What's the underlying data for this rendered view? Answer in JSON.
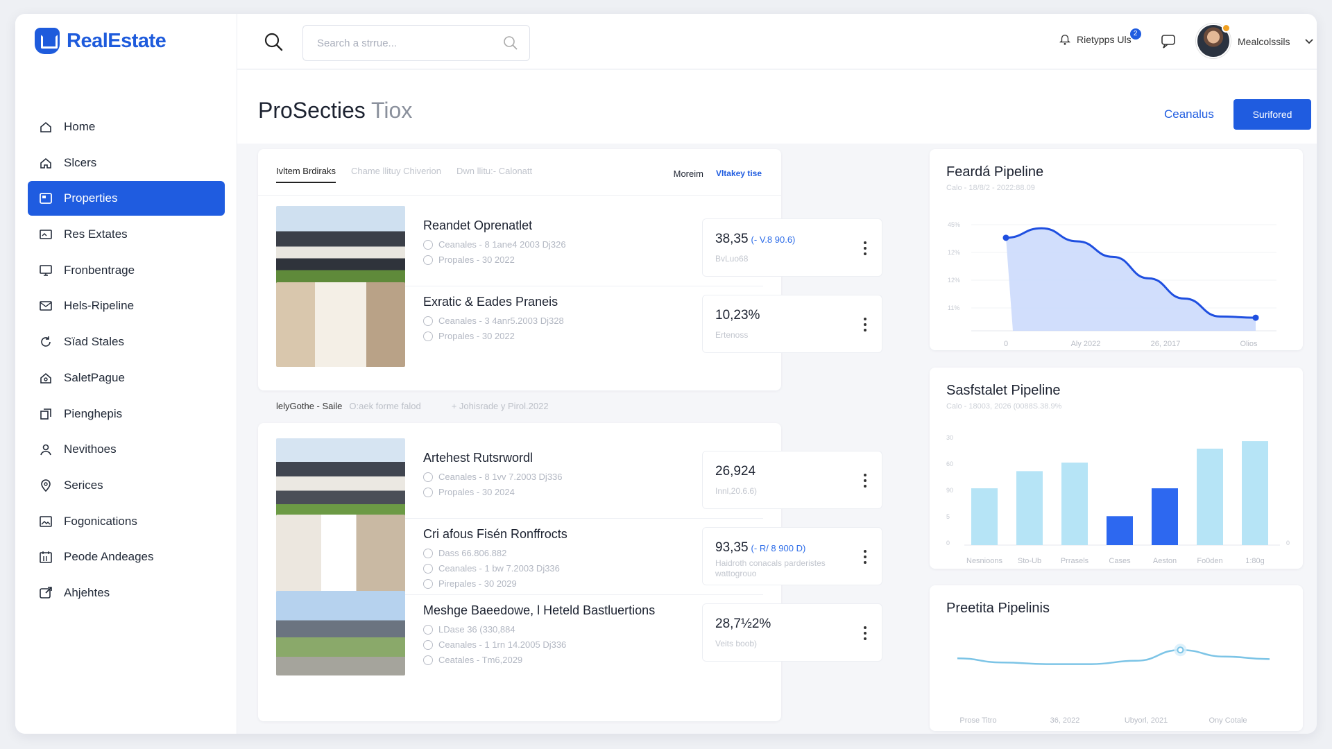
{
  "app": {
    "brand": "RealEstate",
    "brand_color": "#1e5bdc",
    "accent": "#1f5ce0"
  },
  "sidebar": {
    "items": [
      {
        "label": "Home",
        "icon": "home-icon"
      },
      {
        "label": "Slcers",
        "icon": "home-outline-icon"
      },
      {
        "label": "Properties",
        "icon": "properties-icon",
        "active": true
      },
      {
        "label": "Res Extates",
        "icon": "image-icon"
      },
      {
        "label": "Fronbentrage",
        "icon": "monitor-icon"
      },
      {
        "label": "Hels-Ripeline",
        "icon": "mail-chart-icon"
      },
      {
        "label": "Sïad Stales",
        "icon": "refresh-icon"
      },
      {
        "label": "SaletPague",
        "icon": "house-gear-icon"
      },
      {
        "label": "Pienghepis",
        "icon": "copy-icon"
      },
      {
        "label": "Nevithoes",
        "icon": "user-icon"
      },
      {
        "label": "Serices",
        "icon": "location-pin-icon"
      },
      {
        "label": "Fogonications",
        "icon": "photo-icon"
      },
      {
        "label": "Peode Andeages",
        "icon": "calendar-icon"
      },
      {
        "label": "Ahjehtes",
        "icon": "export-icon"
      }
    ]
  },
  "topbar": {
    "search_placeholder": "Search a strrue...",
    "notifications_label": "Rietypps Uls",
    "notifications_count": "2",
    "username": "Mealcolssils"
  },
  "header": {
    "title": "ProSecties",
    "title_suffix": "Tiox",
    "link_button": "Ceanalus",
    "primary_button": "Surifored"
  },
  "listing_top": {
    "tabs": [
      "Ivltem Brdiraks",
      "Chame llituy Chiverion",
      "Dwn llitu:- Calonatt"
    ],
    "right_tabs": [
      "Moreim",
      "Vltakey tise"
    ],
    "rows": [
      {
        "title": "Reandet Oprenatlet",
        "meta": [
          "Ceanales - 8 1ane4 2003 Dj326",
          "Propales - 30 2022"
        ],
        "price": "38,35",
        "change": "(- V.8 90.6)",
        "sub": "BvLuo68"
      },
      {
        "title": "Exratic & Eades Praneis",
        "meta": [
          "Ceanales - 3 4anr5.2003 Dj328",
          "Propales - 30 2022"
        ],
        "price": "10,23%",
        "change": "",
        "sub": "Ertenoss"
      }
    ]
  },
  "section": {
    "label": "lelyGothe - Saile",
    "middle": "O:aek forme falod",
    "right": "+ Johisrade y Pirol.2022"
  },
  "listing_bottom": {
    "rows": [
      {
        "title": "Artehest Rutsrwordl",
        "meta": [
          "Ceanales - 8 1vv 7.2003 Dj336",
          "Propales - 30 2024"
        ],
        "price": "26,924",
        "change": "",
        "sub": "Innl,20.6.6)"
      },
      {
        "title": "Cri afous Fisén Ronffrocts",
        "meta": [
          "Dass 66.806.882",
          "Ceanales - 1 bw 7.2003 Dj336",
          "Pirepales - 30 2029"
        ],
        "price": "93,35",
        "change": "(- R/ 8 900 D)",
        "sub": "Haidroth conacals parderistes wattogrouo"
      },
      {
        "title": "Meshge Baeedowe, l Heteld Bastluertions",
        "meta": [
          "LDase 36 (330,884",
          "Ceanales - 1 1rn 14.2005 Dj336",
          "Ceatales - Tm6,2029"
        ],
        "price": "28,7½2%",
        "change": "",
        "sub": "Veits boob)"
      }
    ]
  },
  "charts": {
    "feard": {
      "title": "Feardá Pipeline",
      "subtitle": "Calo - 18/8/2 - 2022:88.09"
    },
    "sasf": {
      "title": "Sasfstalet Pipeline",
      "subtitle": "Calo - 18003, 2026 (0088S.38.9%"
    },
    "preetita": {
      "title": "Preetita Pipelinis"
    }
  },
  "chart_data": [
    {
      "type": "area",
      "title": "Feardá Pipeline",
      "x_ticks": [
        "0",
        "Aly 2022",
        "26, 2017",
        "Olios"
      ],
      "y_ticks": [
        "45%",
        "12%",
        "12%",
        "11%"
      ],
      "values": [
        0.78,
        0.86,
        0.75,
        0.62,
        0.44,
        0.27,
        0.12,
        0.11
      ],
      "color": "#1f4fe0",
      "fill": "#c9d8fb"
    },
    {
      "type": "bar",
      "title": "Sasfstalet Pipeline",
      "categories": [
        "Nesnioons",
        "Sto-Ub",
        "Prrasels",
        "Cases",
        "Aeston",
        "Fo0den",
        "1:80g"
      ],
      "values": [
        53,
        69,
        77,
        27,
        53,
        90,
        97
      ],
      "colors": [
        "#b6e4f6",
        "#b6e4f6",
        "#b6e4f6",
        "#2d68f0",
        "#2d68f0",
        "#b6e4f6",
        "#b6e4f6"
      ],
      "y_ticks": [
        "30",
        "60",
        "90",
        "5",
        "0"
      ],
      "ylim": [
        0,
        110
      ]
    },
    {
      "type": "line",
      "title": "Preetita Pipelinis",
      "x_ticks": [
        "Prose Titro",
        "36, 2022",
        "Ubyorl, 2021",
        "Ony Cotale"
      ],
      "values": [
        0.58,
        0.48,
        0.44,
        0.44,
        0.52,
        0.78,
        0.62,
        0.56
      ],
      "color": "#7cc4e6"
    }
  ]
}
